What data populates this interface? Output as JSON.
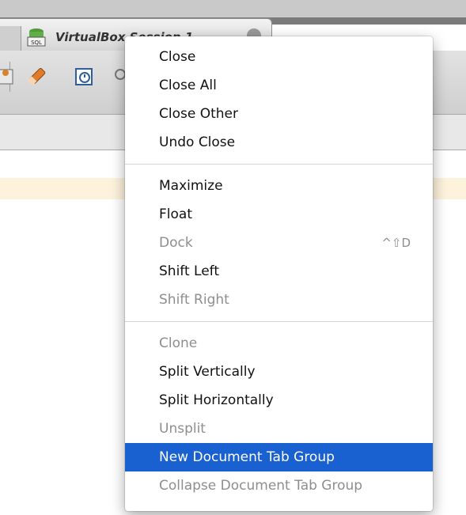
{
  "document_tab": {
    "label": "VirtualBox Session 1"
  },
  "context_menu": {
    "groups": [
      [
        {
          "label": "Close",
          "shortcut": "",
          "enabled": true
        },
        {
          "label": "Close All",
          "shortcut": "",
          "enabled": true
        },
        {
          "label": "Close Other",
          "shortcut": "",
          "enabled": true
        },
        {
          "label": "Undo Close",
          "shortcut": "",
          "enabled": true
        }
      ],
      [
        {
          "label": "Maximize",
          "shortcut": "",
          "enabled": true
        },
        {
          "label": "Float",
          "shortcut": "",
          "enabled": true
        },
        {
          "label": "Dock",
          "shortcut": "^⇧D",
          "enabled": false
        },
        {
          "label": "Shift Left",
          "shortcut": "",
          "enabled": true
        },
        {
          "label": "Shift Right",
          "shortcut": "",
          "enabled": false
        }
      ],
      [
        {
          "label": "Clone",
          "shortcut": "",
          "enabled": false
        },
        {
          "label": "Split Vertically",
          "shortcut": "",
          "enabled": true
        },
        {
          "label": "Split Horizontally",
          "shortcut": "",
          "enabled": true
        },
        {
          "label": "Unsplit",
          "shortcut": "",
          "enabled": false
        },
        {
          "label": "New Document Tab Group",
          "shortcut": "",
          "enabled": true,
          "highlighted": true
        },
        {
          "label": "Collapse Document Tab Group",
          "shortcut": "",
          "enabled": false
        }
      ]
    ]
  },
  "colors": {
    "highlight": "#1960d0",
    "disabled_text": "#8e8e8e",
    "info_strip": "#fdf3dc"
  }
}
